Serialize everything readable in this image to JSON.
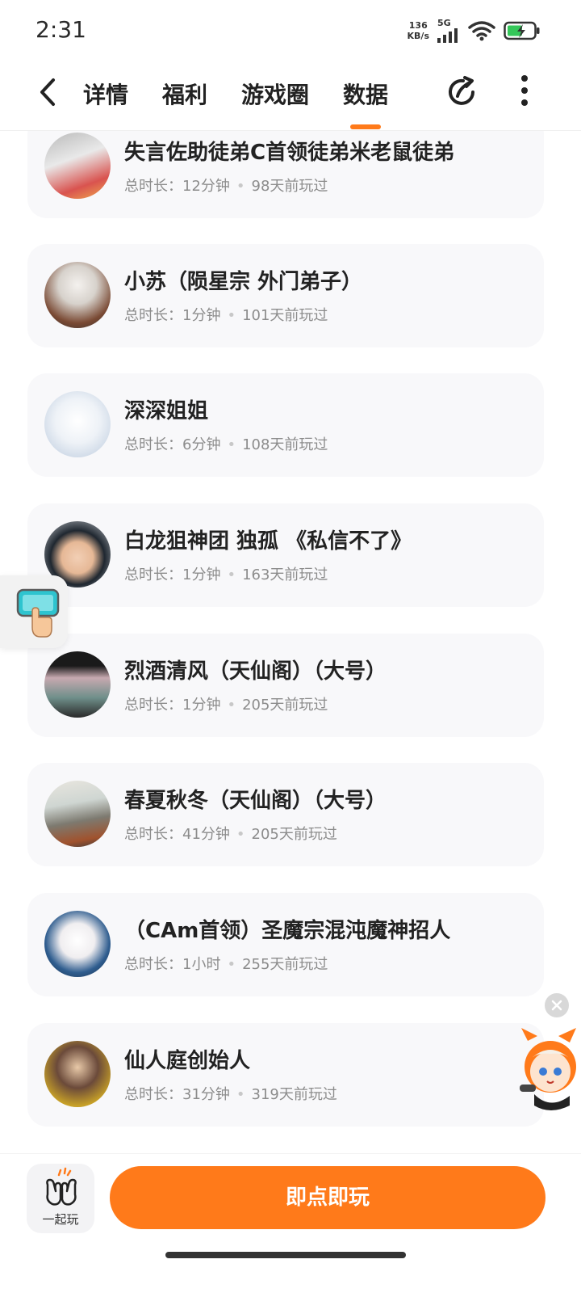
{
  "status_bar": {
    "time": "2:31",
    "net_speed": "136",
    "net_unit": "KB/s",
    "network": "5G"
  },
  "nav": {
    "tabs": [
      {
        "label": "详情"
      },
      {
        "label": "福利"
      },
      {
        "label": "游戏圈"
      },
      {
        "label": "数据"
      }
    ],
    "active_tab": "数据",
    "accent_color": "#ff7a1a"
  },
  "players": [
    {
      "name": "失言佐助徒弟C首领徒弟米老鼠徒弟",
      "duration_label": "总时长：",
      "duration": "12分钟",
      "last_played": "98天前玩过"
    },
    {
      "name": "小苏（陨星宗 外门弟子）",
      "duration_label": "总时长：",
      "duration": "1分钟",
      "last_played": "101天前玩过"
    },
    {
      "name": "深深姐姐",
      "duration_label": "总时长：",
      "duration": "6分钟",
      "last_played": "108天前玩过"
    },
    {
      "name": "白龙狙神团 独孤 《私信不了》",
      "duration_label": "总时长：",
      "duration": "1分钟",
      "last_played": "163天前玩过"
    },
    {
      "name": "烈酒清风（天仙阁）（大号）",
      "duration_label": "总时长：",
      "duration": "1分钟",
      "last_played": "205天前玩过"
    },
    {
      "name": "春夏秋冬（天仙阁）（大号）",
      "duration_label": "总时长：",
      "duration": "41分钟",
      "last_played": "205天前玩过"
    },
    {
      "name": "（CAm首领）圣魔宗混沌魔神招人",
      "duration_label": "总时长：",
      "duration": "1小时",
      "last_played": "255天前玩过"
    },
    {
      "name": "仙人庭创始人",
      "duration_label": "总时长：",
      "duration": "31分钟",
      "last_played": "319天前玩过"
    }
  ],
  "bottom": {
    "together_label": "一起玩",
    "play_label": "即点即玩"
  }
}
